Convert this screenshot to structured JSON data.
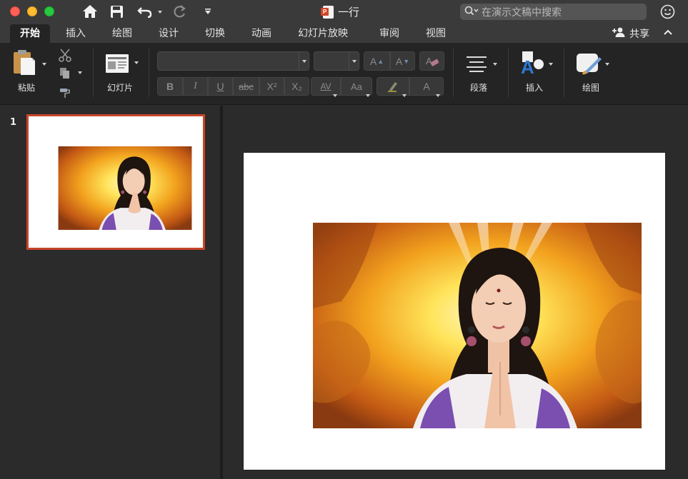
{
  "window": {
    "title": "一行"
  },
  "search": {
    "placeholder": "在演示文稿中搜索"
  },
  "tabs": [
    {
      "label": "开始",
      "active": true
    },
    {
      "label": "插入"
    },
    {
      "label": "绘图"
    },
    {
      "label": "设计"
    },
    {
      "label": "切换"
    },
    {
      "label": "动画"
    },
    {
      "label": "幻灯片放映"
    },
    {
      "label": "审阅"
    },
    {
      "label": "视图"
    }
  ],
  "share": {
    "label": "共享"
  },
  "ribbon": {
    "paste_label": "粘贴",
    "slides_label": "幻灯片",
    "paragraph_label": "段落",
    "insert_label": "插入",
    "draw_label": "绘图",
    "font_name": "",
    "font_size": "",
    "format_buttons": [
      {
        "name": "bold-button",
        "text": "B"
      },
      {
        "name": "italic-button",
        "text": "I"
      },
      {
        "name": "underline-button",
        "text": "U"
      },
      {
        "name": "strikethrough-button",
        "text": "abc"
      },
      {
        "name": "superscript-button",
        "text": "X²"
      },
      {
        "name": "subscript-button",
        "text": "X₂"
      }
    ],
    "grow_font": "A",
    "shrink_font": "A",
    "char_spacing": "AV",
    "change_case": "Aa",
    "font_color": "A"
  },
  "thumbnails": [
    {
      "number": "1",
      "selected": true
    }
  ],
  "colors": {
    "accent": "#c9442a",
    "window_bg": "#2b2b2b",
    "ribbon_bg": "#242424",
    "titlebar_bg": "#3a3a3a"
  }
}
